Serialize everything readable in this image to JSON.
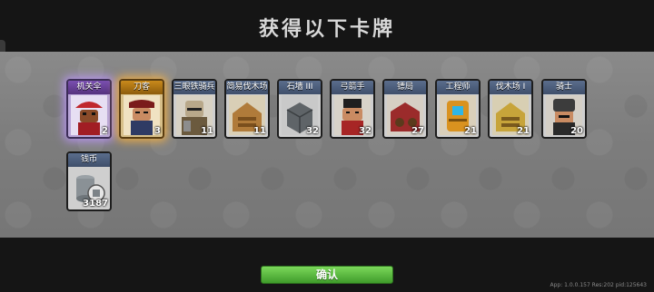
{
  "title": "获得以下卡牌",
  "cards": [
    {
      "name": "机关伞",
      "count": "2",
      "rarity": "epic"
    },
    {
      "name": "刀客",
      "count": "3",
      "rarity": "legendary"
    },
    {
      "name": "三眼铁骑兵",
      "count": "11",
      "rarity": "common"
    },
    {
      "name": "简易伐木场",
      "count": "11",
      "rarity": "common"
    },
    {
      "name": "石墙 III",
      "count": "32",
      "rarity": "common"
    },
    {
      "name": "弓箭手",
      "count": "32",
      "rarity": "common"
    },
    {
      "name": "镖局",
      "count": "27",
      "rarity": "common"
    },
    {
      "name": "工程师",
      "count": "21",
      "rarity": "common"
    },
    {
      "name": "伐木场 I",
      "count": "21",
      "rarity": "common"
    },
    {
      "name": "骑士",
      "count": "20",
      "rarity": "common"
    },
    {
      "name": "钱币",
      "count": "3187",
      "rarity": "common"
    }
  ],
  "confirm_label": "确认",
  "version_text": "App: 1.0.0.157 Res:202 pid:125643",
  "colors": {
    "accent_green": "#4fb436",
    "epic_glow": "#b88cff",
    "legendary_glow": "#ffb43c"
  }
}
